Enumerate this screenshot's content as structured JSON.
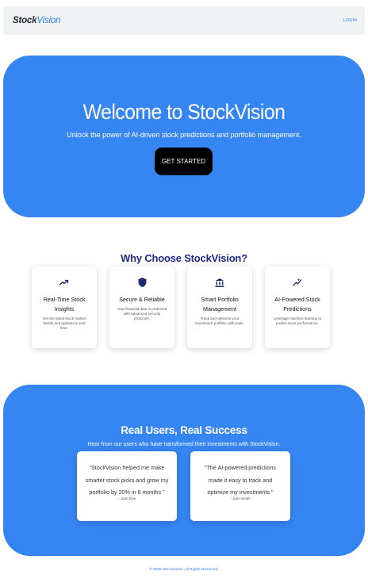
{
  "nav": {
    "brand_part1": "Stock",
    "brand_part2": "Vision",
    "login_label": "LOGIN"
  },
  "hero": {
    "title": "Welcome to StockVision",
    "subtitle": "Unlock the power of AI-driven stock predictions and portfolio management.",
    "cta_label": "GET STARTED"
  },
  "features": {
    "heading": "Why Choose StockVision?",
    "items": [
      {
        "icon": "trending-up-icon",
        "title": "Real-Time Stock Insights",
        "description": "Get the latest stock market trends and updates in real time."
      },
      {
        "icon": "shield-icon",
        "title": "Secure & Reliable",
        "description": "Your financial data is protected with advanced security protocols."
      },
      {
        "icon": "bank-icon",
        "title": "Smart Portfolio Management",
        "description": "Track and optimize your investment portfolio with ease."
      },
      {
        "icon": "insights-icon",
        "title": "AI-Powered Stock Predictions",
        "description": "Leverage machine learning to predict stock performance."
      }
    ]
  },
  "testimonials": {
    "heading": "Real Users, Real Success",
    "subheading": "Hear from our users who have transformed their investments with StockVision.",
    "items": [
      {
        "quote": "\"StockVision helped me make smarter stock picks and grow my portfolio by 20% in 6 months.\"",
        "author": "- John Doe"
      },
      {
        "quote": "\"The AI-powered predictions made it easy to track and optimize my investments.\"",
        "author": "- Jane Smith"
      }
    ]
  },
  "footer": {
    "text": "© 2025 StockVision. All Rights Reserved."
  },
  "colors": {
    "primary": "#3585f3",
    "heading_navy": "#1d2a86",
    "icon_navy": "#1b2a6e",
    "cta_black": "#000000"
  }
}
